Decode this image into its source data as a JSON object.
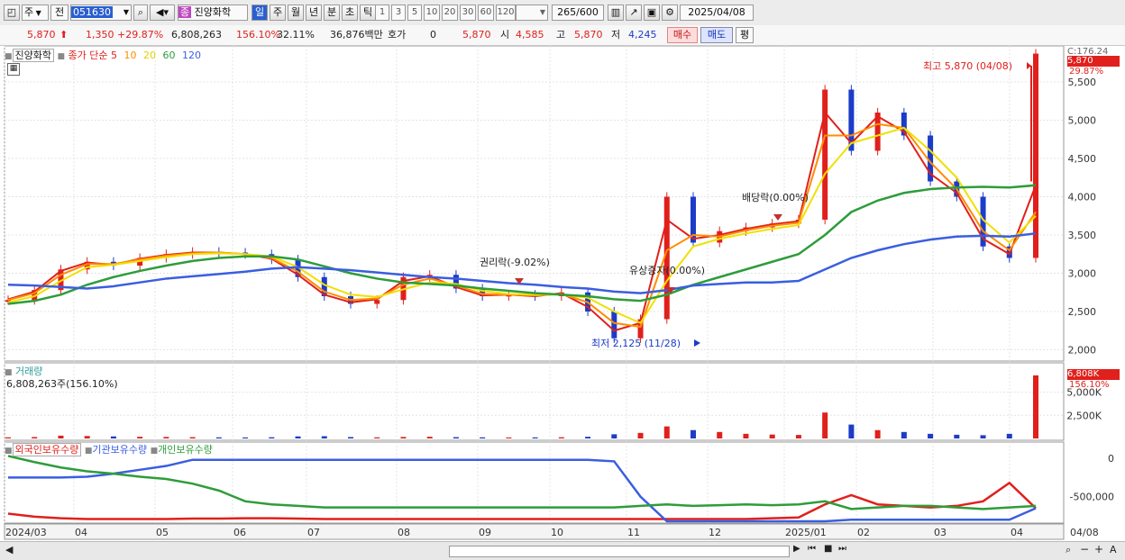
{
  "toolbar": {
    "market_label": "주",
    "prev_label": "전",
    "code": "051630",
    "stock_badge": "종",
    "stock_name": "진양화학",
    "periods": [
      "일",
      "주",
      "월",
      "년",
      "분",
      "초",
      "틱"
    ],
    "intervals": [
      "1",
      "3",
      "5",
      "10",
      "20",
      "30",
      "60",
      "120"
    ],
    "count": "265",
    "count_total": "/600",
    "date": "2025/04/08"
  },
  "quote": {
    "price": "5,870",
    "change": "1,350",
    "change_pct": "+29.87%",
    "volume": "6,808,263",
    "volume_ratio": "156.10%",
    "turnover": "32.11%",
    "amount": "36,876백만",
    "ask_label": "호가",
    "ask_value": "0",
    "ask_price": "5,870",
    "open_label": "시",
    "open": "4,585",
    "high_label": "고",
    "high": "5,870",
    "low_label": "저",
    "low": "4,245",
    "buy_label": "매수",
    "sell_label": "매도",
    "flat_label": "평"
  },
  "legend": {
    "name": "진양화학",
    "close": "종가",
    "simple": "단순",
    "ma5": "5",
    "ma10": "10",
    "ma20": "20",
    "ma60": "60",
    "ma120": "120",
    "volume_title": "거래량",
    "volume_detail": "6,808,263주(156.10%)",
    "investor_foreign": "외국인보유수량",
    "investor_inst": "기관보유수량",
    "investor_indiv": "개인보유수량"
  },
  "annotations": {
    "high": "최고 5,870 (04/08)",
    "low": "최저 2,125 (11/28)",
    "rights": "권리락(-9.02%)",
    "capital": "유상증자(0.00%)",
    "dividend": "배당락(0.00%)",
    "top_right": "C:176.24",
    "price_tag": "5,870",
    "price_tag_pct": "29.87%",
    "vol_tag": "6,808K",
    "vol_tag_pct": "156.10%"
  },
  "colors": {
    "up": "#e0201c",
    "down": "#1c3cc8",
    "ma5": "#e0201c",
    "ma10": "#ff8c00",
    "ma20": "#f0e000",
    "ma60": "#2e9c3a",
    "ma120": "#3a5ee0",
    "foreign": "#e0201c",
    "institution": "#3a5ee0",
    "individual": "#2e9c3a"
  },
  "chart_data": {
    "type": "line",
    "price_axis": {
      "ylim": [
        1900,
        5900
      ],
      "ticks": [
        "2,000",
        "2,500",
        "3,000",
        "3,500",
        "4,000",
        "4,500",
        "5,000",
        "5,500"
      ],
      "tick_values": [
        2000,
        2500,
        3000,
        3500,
        4000,
        4500,
        5000,
        5500
      ]
    },
    "volume_axis": {
      "ticks": [
        "2,500K",
        "5,000K"
      ]
    },
    "investor_axis": {
      "ticks": [
        "0",
        "-500,000"
      ]
    },
    "x_ticks": [
      "2024/03",
      "04",
      "05",
      "06",
      "07",
      "08",
      "09",
      "10",
      "11",
      "12",
      "2025/01",
      "02",
      "03",
      "04",
      "04/08"
    ],
    "series": [
      {
        "name": "종가",
        "values": [
          2650,
          2780,
          3050,
          3150,
          3100,
          3200,
          3250,
          3280,
          3270,
          3250,
          3180,
          2950,
          2700,
          2600,
          2650,
          2950,
          2980,
          2800,
          2700,
          2720,
          2700,
          2750,
          2500,
          2150,
          2400,
          4000,
          3400,
          3550,
          3600,
          3650,
          3700,
          5400,
          4600,
          5100,
          4800,
          4200,
          4000,
          3350,
          3200,
          5870
        ]
      },
      {
        "name": "5",
        "values": [
          2660,
          2760,
          3030,
          3140,
          3110,
          3190,
          3240,
          3270,
          3270,
          3250,
          3190,
          2980,
          2720,
          2620,
          2660,
          2900,
          2960,
          2820,
          2710,
          2720,
          2700,
          2740,
          2560,
          2250,
          2350,
          3700,
          3450,
          3500,
          3580,
          3640,
          3680,
          5100,
          4700,
          5050,
          4850,
          4300,
          4050,
          3450,
          3250,
          4150
        ]
      },
      {
        "name": "10",
        "values": [
          2650,
          2740,
          2980,
          3120,
          3120,
          3180,
          3230,
          3260,
          3270,
          3250,
          3200,
          3020,
          2760,
          2650,
          2670,
          2850,
          2930,
          2840,
          2730,
          2720,
          2710,
          2730,
          2620,
          2350,
          2300,
          3300,
          3500,
          3480,
          3560,
          3620,
          3660,
          4800,
          4800,
          4950,
          4900,
          4450,
          4100,
          3550,
          3300,
          3800
        ]
      },
      {
        "name": "20",
        "values": [
          2620,
          2700,
          2900,
          3080,
          3110,
          3160,
          3210,
          3250,
          3260,
          3250,
          3220,
          3080,
          2850,
          2720,
          2690,
          2790,
          2880,
          2860,
          2770,
          2730,
          2720,
          2720,
          2680,
          2500,
          2350,
          2900,
          3350,
          3450,
          3520,
          3580,
          3630,
          4300,
          4700,
          4800,
          4900,
          4600,
          4250,
          3700,
          3400,
          3750
        ]
      },
      {
        "name": "60",
        "values": [
          2600,
          2640,
          2720,
          2850,
          2950,
          3030,
          3100,
          3160,
          3200,
          3220,
          3220,
          3180,
          3090,
          3000,
          2930,
          2880,
          2860,
          2840,
          2800,
          2770,
          2740,
          2720,
          2700,
          2660,
          2640,
          2720,
          2850,
          2950,
          3050,
          3150,
          3250,
          3500,
          3800,
          3950,
          4050,
          4100,
          4120,
          4130,
          4120,
          4150
        ]
      },
      {
        "name": "120",
        "values": [
          2850,
          2840,
          2820,
          2800,
          2830,
          2880,
          2930,
          2960,
          2990,
          3020,
          3060,
          3080,
          3060,
          3040,
          3010,
          2980,
          2950,
          2930,
          2900,
          2870,
          2850,
          2820,
          2800,
          2760,
          2740,
          2780,
          2840,
          2860,
          2880,
          2880,
          2900,
          3050,
          3200,
          3300,
          3380,
          3440,
          3480,
          3490,
          3480,
          3520
        ]
      }
    ],
    "volume": [
      120,
      150,
      300,
      260,
      220,
      180,
      160,
      140,
      120,
      110,
      130,
      220,
      240,
      150,
      120,
      160,
      180,
      140,
      120,
      110,
      115,
      130,
      180,
      450,
      600,
      1300,
      900,
      700,
      500,
      420,
      380,
      2800,
      1500,
      900,
      700,
      500,
      400,
      350,
      500,
      6808
    ],
    "investor": {
      "foreign": [
        -720,
        -760,
        -780,
        -790,
        -790,
        -790,
        -790,
        -785,
        -785,
        -780,
        -780,
        -785,
        -790,
        -790,
        -790,
        -790,
        -790,
        -790,
        -790,
        -790,
        -790,
        -790,
        -790,
        -790,
        -790,
        -790,
        -790,
        -790,
        -790,
        -780,
        -770,
        -600,
        -480,
        -600,
        -620,
        -640,
        -620,
        -560,
        -320,
        -650
      ],
      "institution": [
        -250,
        -250,
        -250,
        -240,
        -200,
        -150,
        -100,
        -20,
        -20,
        -20,
        -20,
        -20,
        -20,
        -20,
        -20,
        -20,
        -20,
        -20,
        -20,
        -20,
        -20,
        -20,
        -20,
        -40,
        -500,
        -820,
        -820,
        -820,
        -820,
        -820,
        -820,
        -820,
        -800,
        -800,
        -800,
        -800,
        -800,
        -800,
        -800,
        -650
      ],
      "individual": [
        30,
        -50,
        -120,
        -170,
        -200,
        -240,
        -270,
        -330,
        -420,
        -560,
        -600,
        -620,
        -640,
        -640,
        -640,
        -640,
        -640,
        -640,
        -640,
        -640,
        -640,
        -640,
        -640,
        -640,
        -620,
        -600,
        -620,
        -610,
        -600,
        -610,
        -600,
        -560,
        -660,
        -640,
        -620,
        -620,
        -640,
        -660,
        -640,
        -620
      ]
    }
  }
}
